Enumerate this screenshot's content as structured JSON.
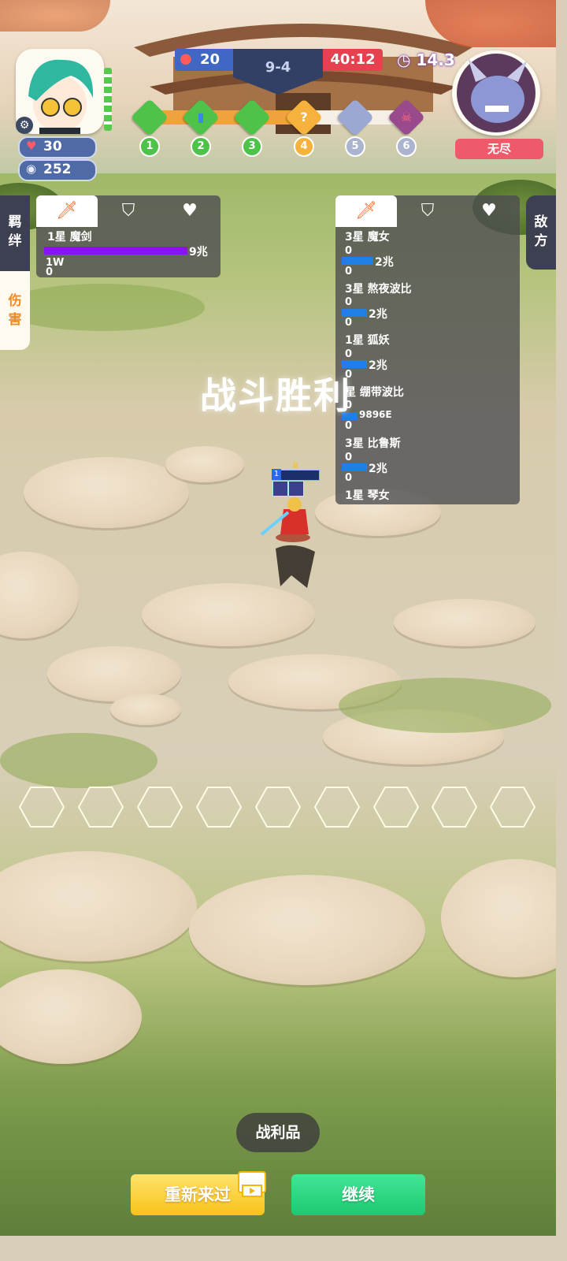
{
  "hud": {
    "gold": "20",
    "round": "9-4",
    "timer": "40:12",
    "clock": "14.3",
    "health": "30",
    "coins": "252",
    "enemy_label": "无尽"
  },
  "stages": [
    {
      "num": "1",
      "state": "done",
      "glyph": ""
    },
    {
      "num": "2",
      "state": "done",
      "glyph": "▮"
    },
    {
      "num": "3",
      "state": "done",
      "glyph": ""
    },
    {
      "num": "4",
      "state": "current",
      "glyph": "?"
    },
    {
      "num": "5",
      "state": "locked",
      "glyph": ""
    },
    {
      "num": "6",
      "state": "boss",
      "glyph": "☠"
    }
  ],
  "side_tabs": {
    "bonds": "羁绊",
    "damage": "伤害",
    "enemy": "敌方"
  },
  "player_panel": {
    "rows": [
      {
        "name": "1星 魔剑",
        "line2": "1W",
        "line3": "0",
        "value": "9兆"
      }
    ]
  },
  "enemy_panel": {
    "rows": [
      {
        "name": "3星 魔女",
        "zero": "0",
        "value": "2兆"
      },
      {
        "name": "3星 熬夜波比",
        "zero": "0",
        "value": "2兆"
      },
      {
        "name": "1星 狐妖",
        "zero": "0",
        "value": "2兆"
      },
      {
        "name": "星 绷带波比",
        "zero": "0",
        "value": "9896E"
      },
      {
        "name": "3星 比鲁斯",
        "zero": "0",
        "value": "2兆"
      },
      {
        "name": "1星 琴女",
        "zero": "",
        "value": ""
      }
    ]
  },
  "banner": "战斗胜利",
  "hero_level": "1",
  "buttons": {
    "loot": "战利品",
    "retry": "重新来过",
    "continue": "继续"
  },
  "colors": {
    "player_bar": "#8a12ee",
    "enemy_bar": "#1f7fe6",
    "gold_box": "#3f67c3",
    "timer_box": "#e5414f",
    "retry": "#f7c21a",
    "continue": "#1cc971"
  },
  "icons": {
    "attack_tab": "sword-icon",
    "defense_tab": "shield-icon",
    "heal_tab": "heart-icon"
  }
}
